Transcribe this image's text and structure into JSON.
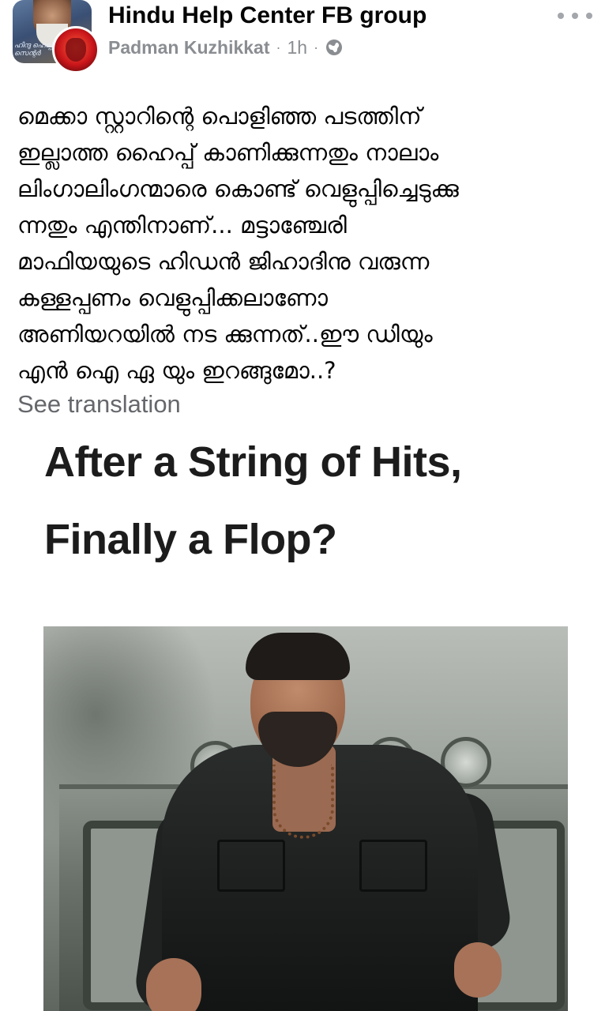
{
  "header": {
    "group_name": "Hindu Help Center FB group",
    "author": "Padman Kuzhikkat",
    "time": "1h",
    "separator": "·",
    "privacy_icon": "globe-icon",
    "more_icon": "more-options-icon",
    "group_avatar_text": "ഹിന്ദു ഹെല്പ് സെന്റർ"
  },
  "post": {
    "lines": [
      "മെക്കാ സ്റ്റാറിന്റെ പൊളിഞ്ഞ പടത്തിന്",
      "ഇല്ലാത്ത ഹൈപ്പ് കാണിക്കുന്നതും നാലാം",
      "ലിംഗാലിംഗന്മാരെ കൊണ്ട് വെളുപ്പിച്ചെടുക്കു",
      "ന്നതും എന്തിനാണ്... മട്ടാഞ്ചേരി",
      "മാഫിയയുടെ ഹിഡൻ ജിഹാദിനു വരുന്ന",
      "കള്ളപ്പണം വെളുപ്പിക്കലാണോ",
      "അണിയറയിൽ നട ക്കുന്നത്..ഈ ഡിയും",
      "എൻ ഐ ഏ യും ഇറങ്ങുമോ..?"
    ],
    "see_translation": "See translation"
  },
  "image": {
    "headline_line1": "After a String of Hits,",
    "headline_line2": "Finally a Flop?"
  }
}
